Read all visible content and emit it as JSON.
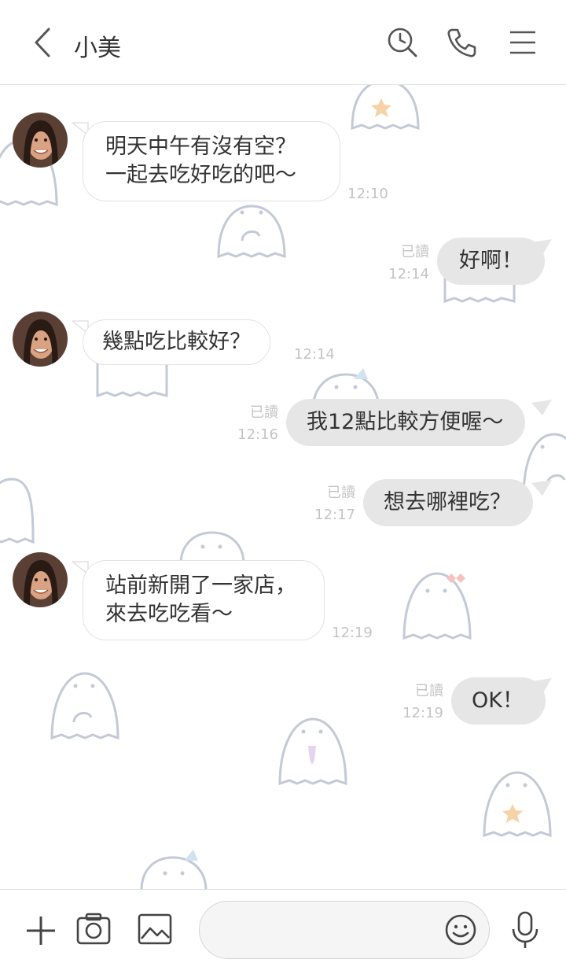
{
  "header": {
    "title": "小美",
    "icons": [
      "chevron-left-icon",
      "clock-search-icon",
      "phone-icon",
      "menu-icon"
    ]
  },
  "messages": [
    {
      "side": "in",
      "lines": [
        "明天中午有沒有空？",
        "一起去吃好吃的吧～"
      ],
      "time": "12:10"
    },
    {
      "side": "out",
      "text": "好啊！",
      "read": "已讀",
      "time": "12:14"
    },
    {
      "side": "in",
      "lines": [
        "幾點吃比較好？"
      ],
      "time": "12:14"
    },
    {
      "side": "out",
      "text": "我12點比較方便喔～",
      "read": "已讀",
      "time": "12:16"
    },
    {
      "side": "out",
      "text": "想去哪裡吃？",
      "read": "已讀",
      "time": "12:17"
    },
    {
      "side": "in",
      "lines": [
        "站前新開了一家店，",
        "來去吃吃看～"
      ],
      "time": "12:19"
    },
    {
      "side": "out",
      "text": "OK！",
      "read": "已讀",
      "time": "12:19"
    }
  ],
  "footer": {
    "input_value": "",
    "icons": [
      "plus-icon",
      "camera-icon",
      "image-icon",
      "emoji-icon",
      "microphone-icon"
    ]
  },
  "colors": {
    "outgoing_bubble": "#e6e6e6",
    "incoming_bubble": "#ffffff",
    "ghost_outline": "#c3c9d6"
  }
}
